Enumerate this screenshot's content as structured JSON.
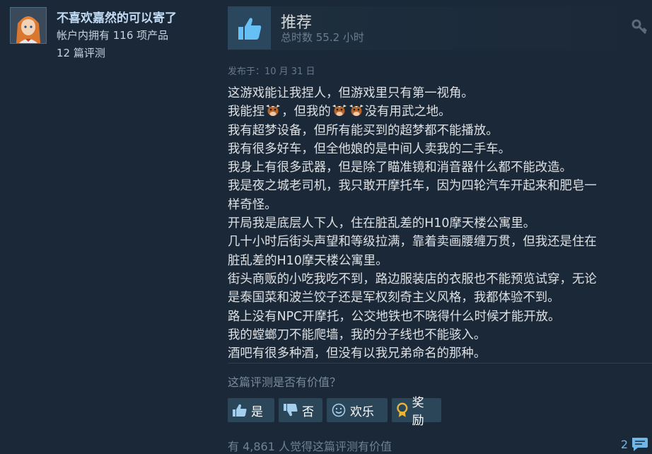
{
  "author": {
    "username": "不喜欢嘉然的可以寄了",
    "products_owned": "帐户内拥有 116 项产品",
    "review_count": "12 篇评测"
  },
  "review": {
    "verdict": "推荐",
    "hours": "总时数 55.2 小时",
    "posted": "发布于：10 月 31 日",
    "lines": [
      "这游戏能让我捏人，但游戏里只有第一视角。",
      [
        "我能捏",
        "，但我的",
        "没有用武之地。"
      ],
      "我有超梦设备，但所有能买到的超梦都不能播放。",
      "我有很多好车，但全他娘的是中间人卖我的二手车。",
      "我身上有很多武器，但是除了瞄准镜和消音器什么都不能改造。",
      "我是夜之城老司机，我只敢开摩托车，因为四轮汽车开起来和肥皂一",
      "样奇怪。",
      "开局我是底层人下人，住在脏乱差的H10摩天楼公寓里。",
      "几十小时后街头声望和等级拉满，靠着卖画腰缠万贯，但我还是住在",
      "脏乱差的H10摩天楼公寓里。",
      "街头商贩的小吃我吃不到，路边服装店的衣服也不能预览试穿，无论",
      "是泰国菜和波兰饺子还是军权刻奇主义风格，我都体验不到。",
      "路上没有NPC开摩托，公交地铁也不晓得什么时候才能开放。",
      "我的螳螂刀不能爬墙，我的分子线也不能骇入。",
      "酒吧有很多种酒，但没有以我兄弟命名的那种。"
    ]
  },
  "feedback": {
    "question": "这篇评测是否有价值？",
    "yes_label": "是",
    "no_label": "否",
    "funny_label": "欢乐",
    "award_label": "奖励",
    "helpful_count": "有 4,861 人觉得这篇评测有价值",
    "comment_count": "2"
  },
  "colors": {
    "background": "#1b2838",
    "button": "#2b4559",
    "thumb_blue": "#66c0f4",
    "award_gold": "#e8b634"
  }
}
